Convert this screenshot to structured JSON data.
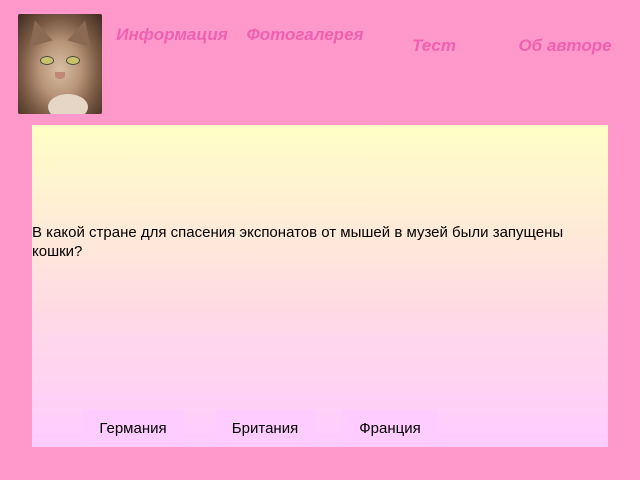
{
  "header": {
    "nav": [
      {
        "label": "Информация"
      },
      {
        "label": "Фотогалерея"
      },
      {
        "label": "Тест"
      },
      {
        "label": "Об авторе"
      }
    ]
  },
  "quiz": {
    "question": "В какой стране для спасения экспонатов от мышей в музей были запущены кошки?",
    "answers": [
      {
        "label": "Германия"
      },
      {
        "label": "Британия"
      },
      {
        "label": "Франция"
      }
    ]
  },
  "colors": {
    "background": "#ff99cc",
    "nav_text": "#f060b0",
    "panel_top": "#ffffc6",
    "panel_bottom": "#ffccff",
    "answer_button": "#ffccff"
  },
  "icons": {
    "avatar": "cat-photo"
  }
}
